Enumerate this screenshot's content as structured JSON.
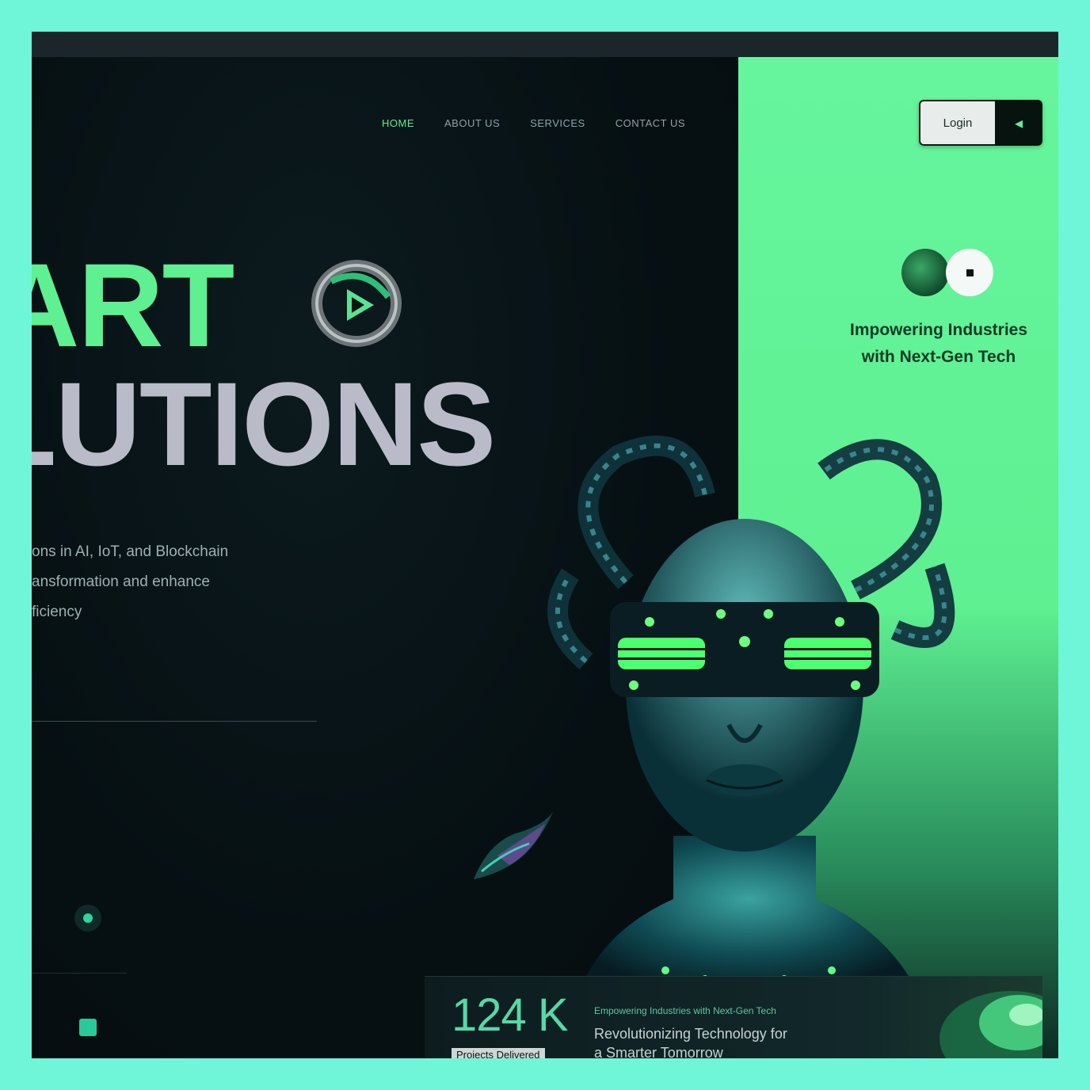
{
  "nav": {
    "items": [
      {
        "label": "HOME",
        "active": true
      },
      {
        "label": "ABOUT US",
        "active": false
      },
      {
        "label": "SERVICES",
        "active": false
      },
      {
        "label": "CONTACT US",
        "active": false
      }
    ]
  },
  "header": {
    "login_label": "Login",
    "login_arrow_icon": "arrow-left-icon"
  },
  "hero": {
    "line1": "ART",
    "line2": "LUTIONS",
    "description_lines": [
      "ons in AI, IoT, and Blockchain",
      "ansformation and enhance",
      "ficiency"
    ]
  },
  "side": {
    "tagline_line1": "Impowering Industries",
    "tagline_line2": "with Next-Gen Tech"
  },
  "stats": {
    "value": "124 K",
    "label": "Projects Delivered",
    "kicker": "Empowering Industries with Next-Gen Tech",
    "headline_line1": "Revolutionizing Technology for",
    "headline_line2": "a Smarter Tomorrow"
  },
  "colors": {
    "accent_green": "#5ef091",
    "page_border": "#6ff5d8",
    "dark_bg": "#071114",
    "hero_silver": "#b9bcc8"
  }
}
